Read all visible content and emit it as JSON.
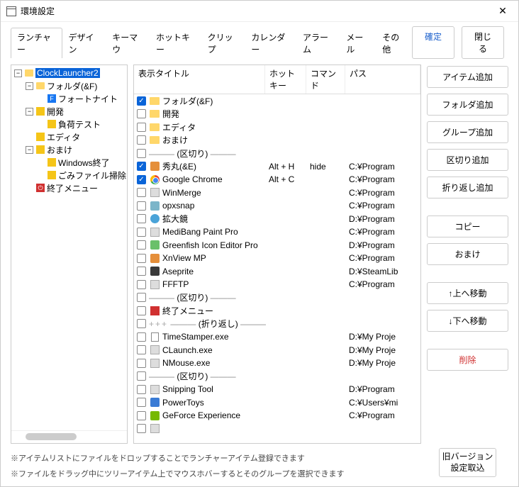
{
  "window": {
    "title": "環境設定"
  },
  "buttons": {
    "ok": "確定",
    "close": "閉じる"
  },
  "tabs": [
    "ランチャー",
    "デザイン",
    "キーマウ",
    "ホットキー",
    "クリップ",
    "カレンダー",
    "アラーム",
    "メール",
    "その他"
  ],
  "tree": [
    {
      "depth": 0,
      "exp": "-",
      "icon": "folder",
      "label": "ClockLauncher2",
      "selected": true
    },
    {
      "depth": 1,
      "exp": "-",
      "icon": "folder",
      "label": "フォルダ(&F)"
    },
    {
      "depth": 2,
      "exp": "",
      "icon": "blue-f",
      "label": "フォートナイト"
    },
    {
      "depth": 1,
      "exp": "-",
      "icon": "yellow",
      "label": "開発"
    },
    {
      "depth": 2,
      "exp": "",
      "icon": "yellow",
      "label": "負荷テスト"
    },
    {
      "depth": 1,
      "exp": "",
      "icon": "yellow",
      "label": "エディタ"
    },
    {
      "depth": 1,
      "exp": "-",
      "icon": "yellow",
      "label": "おまけ"
    },
    {
      "depth": 2,
      "exp": "",
      "icon": "yellow",
      "label": "Windows終了"
    },
    {
      "depth": 2,
      "exp": "",
      "icon": "yellow",
      "label": "ごみファイル掃除"
    },
    {
      "depth": 1,
      "exp": "",
      "icon": "red-o",
      "label": "終了メニュー"
    }
  ],
  "list_headers": {
    "title": "表示タイトル",
    "hotkey": "ホットキー",
    "cmd": "コマンド",
    "path": "パス"
  },
  "items": [
    {
      "chk": true,
      "icon": "folder",
      "title": "フォルダ(&F)",
      "hotkey": "",
      "cmd": "",
      "path": ""
    },
    {
      "chk": false,
      "icon": "folder",
      "title": "開発",
      "hotkey": "",
      "cmd": "",
      "path": ""
    },
    {
      "chk": false,
      "icon": "folder",
      "title": "エディタ",
      "hotkey": "",
      "cmd": "",
      "path": ""
    },
    {
      "chk": false,
      "icon": "folder",
      "title": "おまけ",
      "hotkey": "",
      "cmd": "",
      "path": ""
    },
    {
      "sep": "divider"
    },
    {
      "chk": true,
      "icon": "hidemaru",
      "title": "秀丸(&E)",
      "hotkey": "Alt + H",
      "cmd": "hide",
      "path": "C:¥Program"
    },
    {
      "chk": true,
      "icon": "chrome",
      "title": "Google Chrome",
      "hotkey": "Alt + C",
      "cmd": "",
      "path": "C:¥Program"
    },
    {
      "chk": false,
      "icon": "generic",
      "title": "WinMerge",
      "hotkey": "",
      "cmd": "",
      "path": "C:¥Program"
    },
    {
      "chk": false,
      "icon": "cyan",
      "title": "opxsnap",
      "hotkey": "",
      "cmd": "",
      "path": "C:¥Program"
    },
    {
      "chk": false,
      "icon": "magnify",
      "title": "拡大鏡",
      "hotkey": "",
      "cmd": "",
      "path": "D:¥Program"
    },
    {
      "chk": false,
      "icon": "generic",
      "title": "MediBang Paint Pro",
      "hotkey": "",
      "cmd": "",
      "path": "C:¥Program"
    },
    {
      "chk": false,
      "icon": "green",
      "title": "Greenfish Icon Editor Pro",
      "hotkey": "",
      "cmd": "",
      "path": "D:¥Program"
    },
    {
      "chk": false,
      "icon": "orange",
      "title": "XnView MP",
      "hotkey": "",
      "cmd": "",
      "path": "C:¥Program"
    },
    {
      "chk": false,
      "icon": "dark",
      "title": "Aseprite",
      "hotkey": "",
      "cmd": "",
      "path": "D:¥SteamLib"
    },
    {
      "chk": false,
      "icon": "generic",
      "title": "FFFTP",
      "hotkey": "",
      "cmd": "",
      "path": "C:¥Program"
    },
    {
      "sep": "divider"
    },
    {
      "chk": false,
      "icon": "red",
      "title": "終了メニュー",
      "hotkey": "",
      "cmd": "",
      "path": ""
    },
    {
      "sep": "fold"
    },
    {
      "chk": false,
      "icon": "page",
      "title": "TimeStamper.exe",
      "hotkey": "",
      "cmd": "",
      "path": "D:¥My Proje"
    },
    {
      "chk": false,
      "icon": "generic",
      "title": "CLaunch.exe",
      "hotkey": "",
      "cmd": "",
      "path": "D:¥My Proje"
    },
    {
      "chk": false,
      "icon": "generic",
      "title": "NMouse.exe",
      "hotkey": "",
      "cmd": "",
      "path": "D:¥My Proje"
    },
    {
      "sep": "divider"
    },
    {
      "chk": false,
      "icon": "generic",
      "title": "Snipping Tool",
      "hotkey": "",
      "cmd": "",
      "path": "D:¥Program"
    },
    {
      "chk": false,
      "icon": "blue",
      "title": "PowerToys",
      "hotkey": "",
      "cmd": "",
      "path": "C:¥Users¥mi"
    },
    {
      "chk": false,
      "icon": "nv",
      "title": "GeForce Experience",
      "hotkey": "",
      "cmd": "",
      "path": "C:¥Program"
    },
    {
      "chk": false,
      "icon": "generic",
      "title": "",
      "hotkey": "",
      "cmd": "",
      "path": ""
    }
  ],
  "sep_labels": {
    "divider": "(区切り)",
    "fold": "(折り返し)"
  },
  "side": [
    "アイテム追加",
    "フォルダ追加",
    "グループ追加",
    "区切り追加",
    "折り返し追加",
    "コピー",
    "おまけ",
    "↑上へ移動",
    "↓下へ移動",
    "削除"
  ],
  "legacy_btn": "旧バージョン\n設定取込",
  "hints": [
    "※アイテムリストにファイルをドロップすることでランチャーアイテム登録できます",
    "※ファイルをドラッグ中にツリーアイテム上でマウスホバーするとそのグループを選択できます"
  ]
}
